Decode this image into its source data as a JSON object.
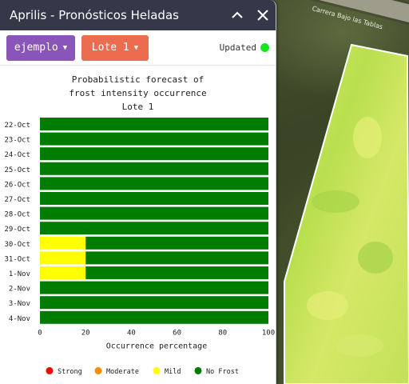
{
  "window": {
    "title": "Aprilis - Pronósticos Heladas"
  },
  "toolbar": {
    "farm_dropdown": "ejemplo",
    "lot_dropdown": "Lote 1",
    "status_text": "Updated",
    "status_color": "#18e41f"
  },
  "map": {
    "road_label": "Carrera Bajo las Tablas"
  },
  "chart_data": {
    "type": "bar",
    "orientation": "horizontal",
    "stacked": true,
    "title_lines": [
      "Probabilistic forecast of",
      "frost intensity occurrence",
      "Lote 1"
    ],
    "categories": [
      "22-Oct",
      "23-Oct",
      "24-Oct",
      "25-Oct",
      "26-Oct",
      "27-Oct",
      "28-Oct",
      "29-Oct",
      "30-Oct",
      "31-Oct",
      "1-Nov",
      "2-Nov",
      "3-Nov",
      "4-Nov"
    ],
    "series": [
      {
        "name": "Strong",
        "color": "#ff0000",
        "values": [
          0,
          0,
          0,
          0,
          0,
          0,
          0,
          0,
          0,
          0,
          0,
          0,
          0,
          0
        ]
      },
      {
        "name": "Moderate",
        "color": "#ff8c00",
        "values": [
          0,
          0,
          0,
          0,
          0,
          0,
          0,
          0,
          0,
          0,
          0,
          0,
          0,
          0
        ]
      },
      {
        "name": "Mild",
        "color": "#ffff00",
        "values": [
          0,
          0,
          0,
          0,
          0,
          0,
          0,
          0,
          20,
          20,
          20,
          0,
          0,
          0
        ]
      },
      {
        "name": "No Frost",
        "color": "#007c00",
        "values": [
          100,
          100,
          100,
          100,
          100,
          100,
          100,
          100,
          80,
          80,
          80,
          100,
          100,
          100
        ]
      }
    ],
    "xlabel": "Occurrence percentage",
    "xticks": [
      0,
      20,
      40,
      60,
      80,
      100
    ],
    "xlim": [
      0,
      100
    ],
    "legend_position": "bottom"
  }
}
